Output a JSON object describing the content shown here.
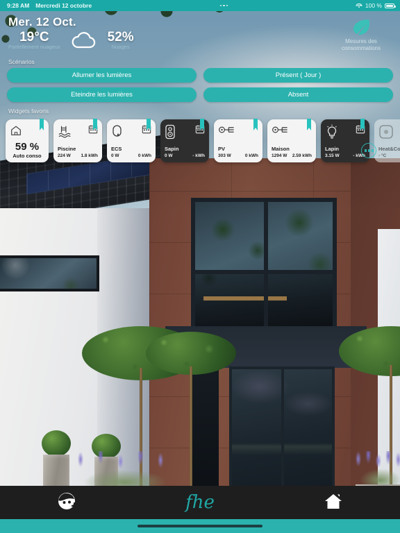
{
  "statusbar": {
    "time": "9:28 AM",
    "date": "Mercredi 12 octobre",
    "battery": "100 %"
  },
  "weather": {
    "date": "Mer. 12 Oct.",
    "temperature": "19°C",
    "temperature_sub": "Partiellement nuageux",
    "humidity": "52%",
    "humidity_sub": "Nuages",
    "cloud_icon": "cloud-icon"
  },
  "measures": {
    "icon": "leaf-icon",
    "label": "Mesures des consommations"
  },
  "scenarios": {
    "title": "Scénarios",
    "buttons": [
      {
        "label": "Allumer les lumières"
      },
      {
        "label": "Présent ( Jour )"
      },
      {
        "label": "Eteindre les lumières"
      },
      {
        "label": "Absent"
      }
    ]
  },
  "widgets": {
    "title": "Widgets favoris",
    "items": [
      {
        "id": "auto-conso",
        "style": "light",
        "icon": "house-outline-icon",
        "value": "59 %",
        "name": "Auto conso",
        "power": "",
        "energy": ""
      },
      {
        "id": "piscine",
        "style": "light",
        "icon": "pool-icon",
        "secondary_icon": "calendar-icon",
        "name": "Piscine",
        "power": "224 W",
        "energy": "1.8 kWh"
      },
      {
        "id": "ecs",
        "style": "light",
        "icon": "water-heater-icon",
        "secondary_icon": "calendar-icon",
        "name": "ECS",
        "power": "0 W",
        "energy": "0 kWh"
      },
      {
        "id": "sapin",
        "style": "dark",
        "icon": "smart-plug-icon",
        "secondary_icon": "calendar-icon",
        "name": "Sapin",
        "power": "0 W",
        "energy": "- kWh"
      },
      {
        "id": "pv",
        "style": "light",
        "icon": "energy-meter-icon",
        "name": "PV",
        "power": "303 W",
        "energy": "0 kWh"
      },
      {
        "id": "maison",
        "style": "light",
        "icon": "energy-meter-icon",
        "name": "Maison",
        "power": "1294 W",
        "energy": "2.59 kWh"
      },
      {
        "id": "lapin",
        "style": "dark",
        "icon": "light-bulb-icon",
        "secondary_icon": "calendar-icon",
        "name": "Lapin",
        "power": "3.15 W",
        "energy": "- kWh"
      },
      {
        "id": "heat-cool",
        "style": "ghost",
        "icon": "thermostat-icon",
        "secondary_icon": "calendar-check-icon",
        "name": "Heat&Cool",
        "power": "- °C",
        "energy": ""
      }
    ]
  },
  "navbar": {
    "assistant_icon": "assistant-face-icon",
    "logo": "fhe",
    "home_icon": "home-icon"
  },
  "colors": {
    "accent": "#2bb2ae",
    "accent_bright": "#27c2bd",
    "logo": "#1fa8a5",
    "dark_card": "#2e2e2e",
    "light_card": "#f4f4f4"
  }
}
